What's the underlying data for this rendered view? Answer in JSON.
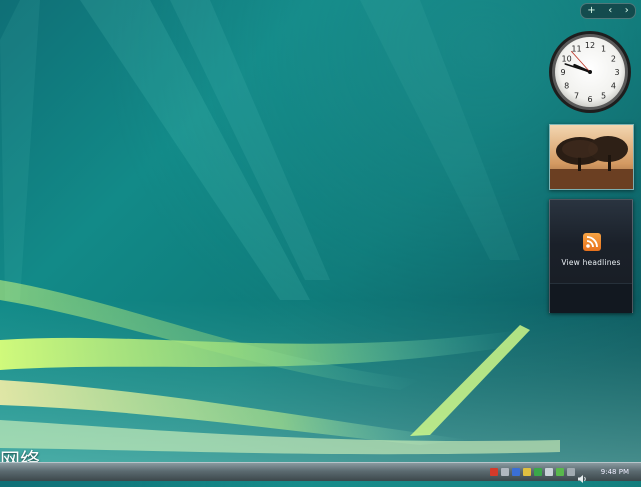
{
  "desktop": {
    "network_label": "网络"
  },
  "gadgets": {
    "toolbar": {
      "add": "+",
      "prev": "‹",
      "next": "›"
    },
    "clock": {
      "numerals": [
        "12",
        "1",
        "2",
        "3",
        "4",
        "5",
        "6",
        "7",
        "8",
        "9",
        "10",
        "11"
      ],
      "time": {
        "hour": 9,
        "minute": 48,
        "second": 53
      }
    },
    "feed": {
      "label": "View headlines"
    }
  },
  "taskbar": {
    "clock_text": "9:48 PM",
    "tray_icons": [
      {
        "name": "tray-security-icon",
        "color": "#d33a2a"
      },
      {
        "name": "tray-app-icon",
        "color": "#b0b8c0"
      },
      {
        "name": "tray-network-icon",
        "color": "#3a6fd6"
      },
      {
        "name": "tray-status-icon",
        "color": "#e0c040"
      },
      {
        "name": "tray-shield-icon",
        "color": "#3aa84a"
      },
      {
        "name": "tray-update-icon",
        "color": "#c9d2d8"
      },
      {
        "name": "tray-sync-icon",
        "color": "#58b84c"
      },
      {
        "name": "tray-device-icon",
        "color": "#a0aab0"
      }
    ],
    "speaker_icon": "speaker-icon"
  },
  "colors": {
    "wallpaper": "#0f7478",
    "streak_green": "#b8f070",
    "accent_orange": "#f08a2a"
  }
}
